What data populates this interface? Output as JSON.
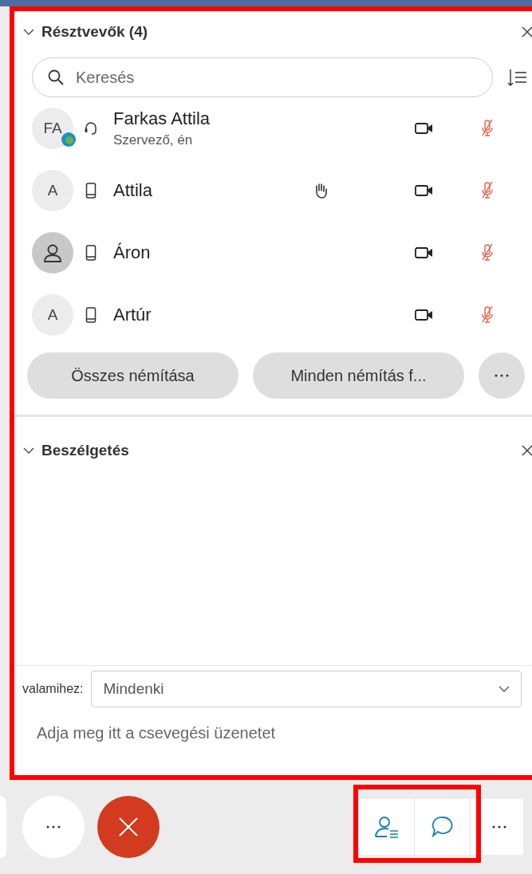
{
  "participants_panel": {
    "title": "Résztvevők (4)",
    "expanded": true,
    "search": {
      "placeholder": "Keresés"
    },
    "participants": [
      {
        "initials": "FA",
        "badge": true,
        "kind": "headset",
        "name": "Farkas Attila",
        "subtitle": "Szervező, én",
        "hand_raised": false,
        "muted": true
      },
      {
        "initials": "A",
        "badge": false,
        "kind": "phone",
        "name": "Attila",
        "hand_raised": true,
        "muted": true
      },
      {
        "badge": false,
        "kind": "phone",
        "name": "Áron",
        "hand_raised": false,
        "muted": true
      },
      {
        "initials": "A",
        "badge": false,
        "kind": "phone",
        "name": "Artúr",
        "hand_raised": false,
        "muted": true
      }
    ],
    "buttons": [
      "Összes némítása",
      "Minden némítás f..."
    ]
  },
  "chat_panel": {
    "title": "Beszélgetés",
    "expanded": true,
    "to_label": "valamihez:",
    "to_value": "Mindenki",
    "message": {
      "placeholder": "Adja meg itt a csevegési üzenetet"
    }
  },
  "toolbar": {
    "panels": [
      {
        "kind": "participants",
        "selected": true
      },
      {
        "kind": "chat",
        "selected": true
      }
    ]
  }
}
